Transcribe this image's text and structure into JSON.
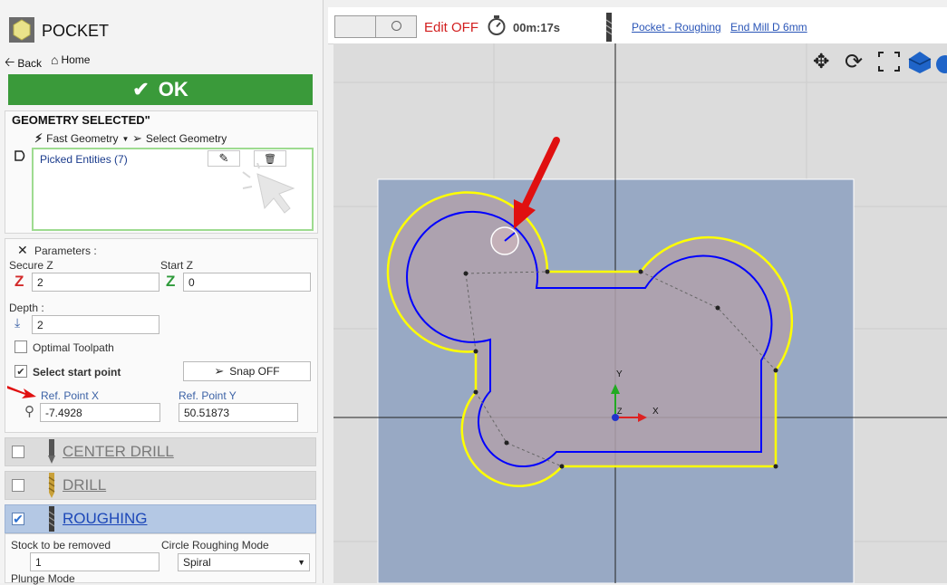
{
  "panel": {
    "title": "POCKET",
    "back": "Back",
    "home": "Home",
    "ok": "OK"
  },
  "geometry": {
    "title": "GEOMETRY SELECTED\"",
    "fast": "Fast Geometry",
    "select": "Select Geometry",
    "picked": "Picked Entities (7)"
  },
  "params": {
    "title": "Parameters :",
    "secure_z_label": "Secure Z",
    "secure_z": "2",
    "start_z_label": "Start Z",
    "start_z": "0",
    "depth_label": "Depth :",
    "depth": "2",
    "optimal": "Optimal Toolpath",
    "select_start": "Select start point",
    "snap": "Snap OFF",
    "ref_x_label": "Ref. Point X",
    "ref_x": "-7.4928",
    "ref_y_label": "Ref. Point Y",
    "ref_y": "50.51873"
  },
  "tools": [
    {
      "label": "CENTER DRILL",
      "checked": false
    },
    {
      "label": "DRILL",
      "checked": false
    },
    {
      "label": "ROUGHING",
      "checked": true
    }
  ],
  "roughing": {
    "stock_label": "Stock to be removed",
    "stock": "1",
    "circle_label": "Circle Roughing Mode",
    "circle": "Spiral",
    "plunge_label": "Plunge Mode"
  },
  "toolbar": {
    "edit": "Edit OFF",
    "timer": "00m:17s",
    "op_link": "Pocket - Roughing",
    "tool_link": "End Mill D 6mm"
  },
  "axes": {
    "x": "X",
    "y": "Y",
    "z": "Z"
  },
  "colors": {
    "ok_green": "#3a9a3a",
    "outline_yellow": "#ffff00",
    "toolpath_blue": "#0000ff",
    "stock": "#98a9c4",
    "arrow_red": "#e01010"
  }
}
